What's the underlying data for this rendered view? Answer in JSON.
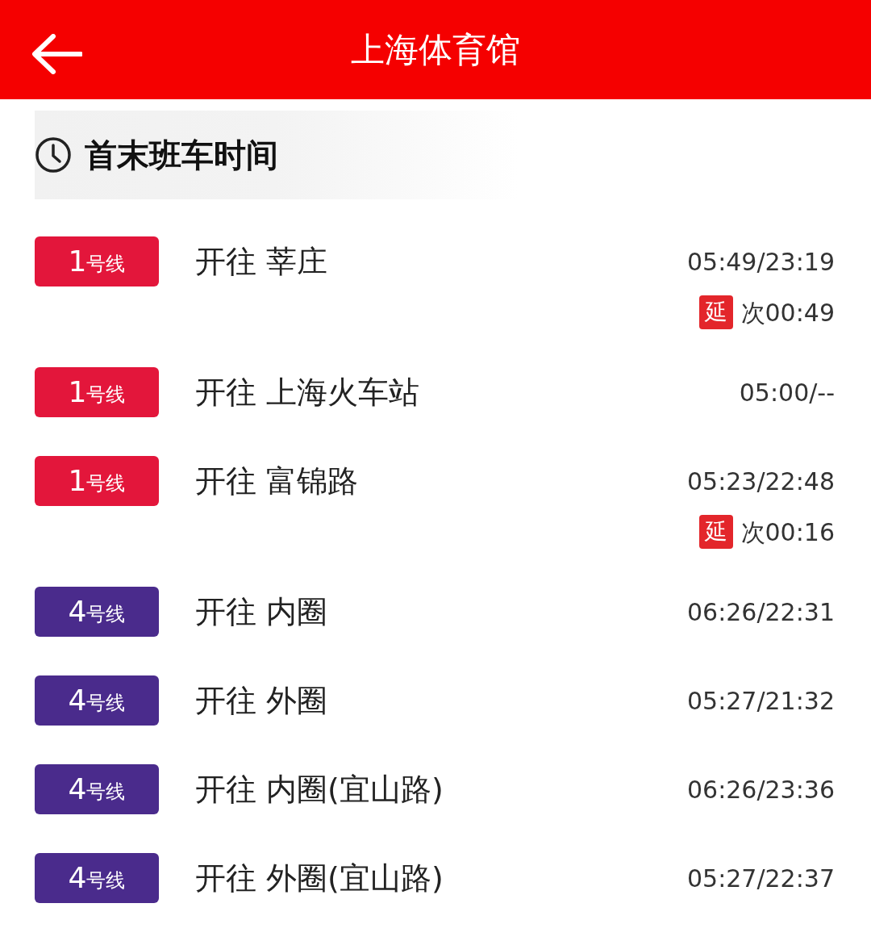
{
  "header": {
    "title": "上海体育馆"
  },
  "section": {
    "title": "首末班车时间"
  },
  "rows": [
    {
      "line_number": "1",
      "line_suffix": "号线",
      "color": "#e3163b",
      "destination": "开往 莘庄",
      "times": "05:49/23:19",
      "extended": true,
      "extended_tag": "延",
      "extended_time": "次00:49"
    },
    {
      "line_number": "1",
      "line_suffix": "号线",
      "color": "#e3163b",
      "destination": "开往 上海火车站",
      "times": "05:00/--",
      "extended": false
    },
    {
      "line_number": "1",
      "line_suffix": "号线",
      "color": "#e3163b",
      "destination": "开往 富锦路",
      "times": "05:23/22:48",
      "extended": true,
      "extended_tag": "延",
      "extended_time": "次00:16"
    },
    {
      "line_number": "4",
      "line_suffix": "号线",
      "color": "#4a2b8c",
      "destination": "开往 内圈",
      "times": "06:26/22:31",
      "extended": false
    },
    {
      "line_number": "4",
      "line_suffix": "号线",
      "color": "#4a2b8c",
      "destination": "开往 外圈",
      "times": "05:27/21:32",
      "extended": false
    },
    {
      "line_number": "4",
      "line_suffix": "号线",
      "color": "#4a2b8c",
      "destination": "开往 内圈(宜山路)",
      "times": "06:26/23:36",
      "extended": false
    },
    {
      "line_number": "4",
      "line_suffix": "号线",
      "color": "#4a2b8c",
      "destination": "开往 外圈(宜山路)",
      "times": "05:27/22:37",
      "extended": false
    }
  ]
}
